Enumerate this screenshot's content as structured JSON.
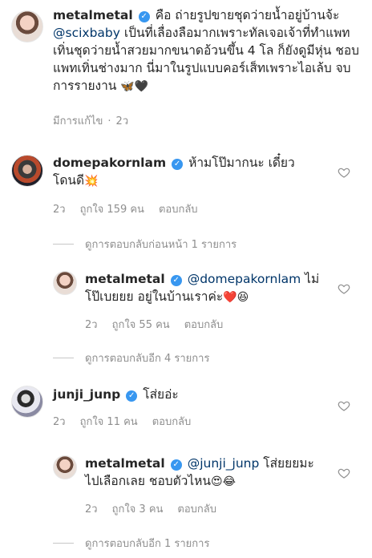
{
  "post_caption": {
    "username": "metalmetal",
    "verified_symbol": "✓",
    "text_before_mention": "คือ ถ่ายรูปขายชุดว่ายน้ำอยู่บ้านจ้ะ ",
    "mention": "@scixbaby",
    "text_after_mention": " เป็นที่เลื่องลือมากเพราะทัลเจอเจ้าที่ทำแพทเทิ่นชุดว่ายน้ำสวยมากขนาดอ้วนขึ้น 4 โล ก็ยังดูมีหุ่น ชอบแพทเทิ่นช่างมาก นี่มาในรูปแบบคอร์เส็ทเพราะไอเล้บ จบการรายงาน ",
    "emojis": "🦋🖤",
    "edited_label": "มีการแก้ไข",
    "time": "2ว"
  },
  "comments": [
    {
      "username": "domepakornlam",
      "verified_symbol": "✓",
      "text": "ห้ามโป๊มากนะ เดี๋ยวโดนดี",
      "emoji": "💥",
      "time": "2ว",
      "likes": "ถูกใจ 159 คน",
      "reply_label": "ตอบกลับ",
      "view_previous_replies": "ดูการตอบกลับก่อนหน้า 1 รายการ",
      "reply": {
        "username": "metalmetal",
        "verified_symbol": "✓",
        "mention": "@domepakornlam",
        "text": " ไม่โป๊เบยยย อยู่ในบ้านเราค่ะ",
        "emojis": "❤️😆",
        "time": "2ว",
        "likes": "ถูกใจ 55 คน",
        "reply_label": "ตอบกลับ"
      },
      "view_more_replies": "ดูการตอบกลับอีก 4 รายการ"
    },
    {
      "username": "junji_junp",
      "verified_symbol": "✓",
      "text": "โส่ยอ่ะ",
      "time": "2ว",
      "likes": "ถูกใจ 11 คน",
      "reply_label": "ตอบกลับ",
      "reply": {
        "username": "metalmetal",
        "verified_symbol": "✓",
        "mention": "@junji_junp",
        "text": " โส่ยยยมะไปเลือกเลย ชอบตัวไหน",
        "emojis": "😍😂",
        "time": "2ว",
        "likes": "ถูกใจ 3 คน",
        "reply_label": "ตอบกลับ"
      },
      "view_more_replies": "ดูการตอบกลับอีก 1 รายการ"
    }
  ],
  "icons": {
    "like": "heart-outline-icon",
    "verified": "verified-badge-icon"
  },
  "colors": {
    "verified_blue": "#3897f0",
    "mention_blue": "#003569",
    "meta_gray": "#8e8e8e"
  }
}
